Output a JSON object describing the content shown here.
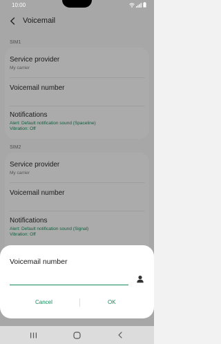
{
  "status_bar": {
    "time": "10:00"
  },
  "header": {
    "title": "Voicemail"
  },
  "sim1": {
    "label": "SIM1",
    "service_provider": {
      "title": "Service provider",
      "value": "My carrier"
    },
    "voicemail_number": {
      "title": "Voicemail number"
    },
    "notifications": {
      "title": "Notifications",
      "alert": "Alert: Default notification sound (Spaceline)",
      "vibration": "Vibration: Off"
    }
  },
  "sim2": {
    "label": "SIM2",
    "service_provider": {
      "title": "Service provider",
      "value": "My carrier"
    },
    "voicemail_number": {
      "title": "Voicemail number"
    },
    "notifications": {
      "title": "Notifications",
      "alert": "Alert: Default notification sound (Signal)",
      "vibration": "Vibration: Off"
    }
  },
  "dialog": {
    "title": "Voicemail number",
    "input_value": "",
    "cancel_label": "Cancel",
    "ok_label": "OK"
  },
  "colors": {
    "accent": "#16895a",
    "background": "#f2f2f2",
    "card": "#fcfcfc",
    "nav_bar": "#dcdcdc"
  },
  "icons": {
    "back": "chevron-left-icon",
    "contact": "person-icon",
    "nav_recents": "recents-icon",
    "nav_home": "home-icon",
    "nav_back": "back-arrow-icon",
    "wifi": "wifi-icon",
    "signal": "signal-icon",
    "battery": "battery-icon"
  }
}
